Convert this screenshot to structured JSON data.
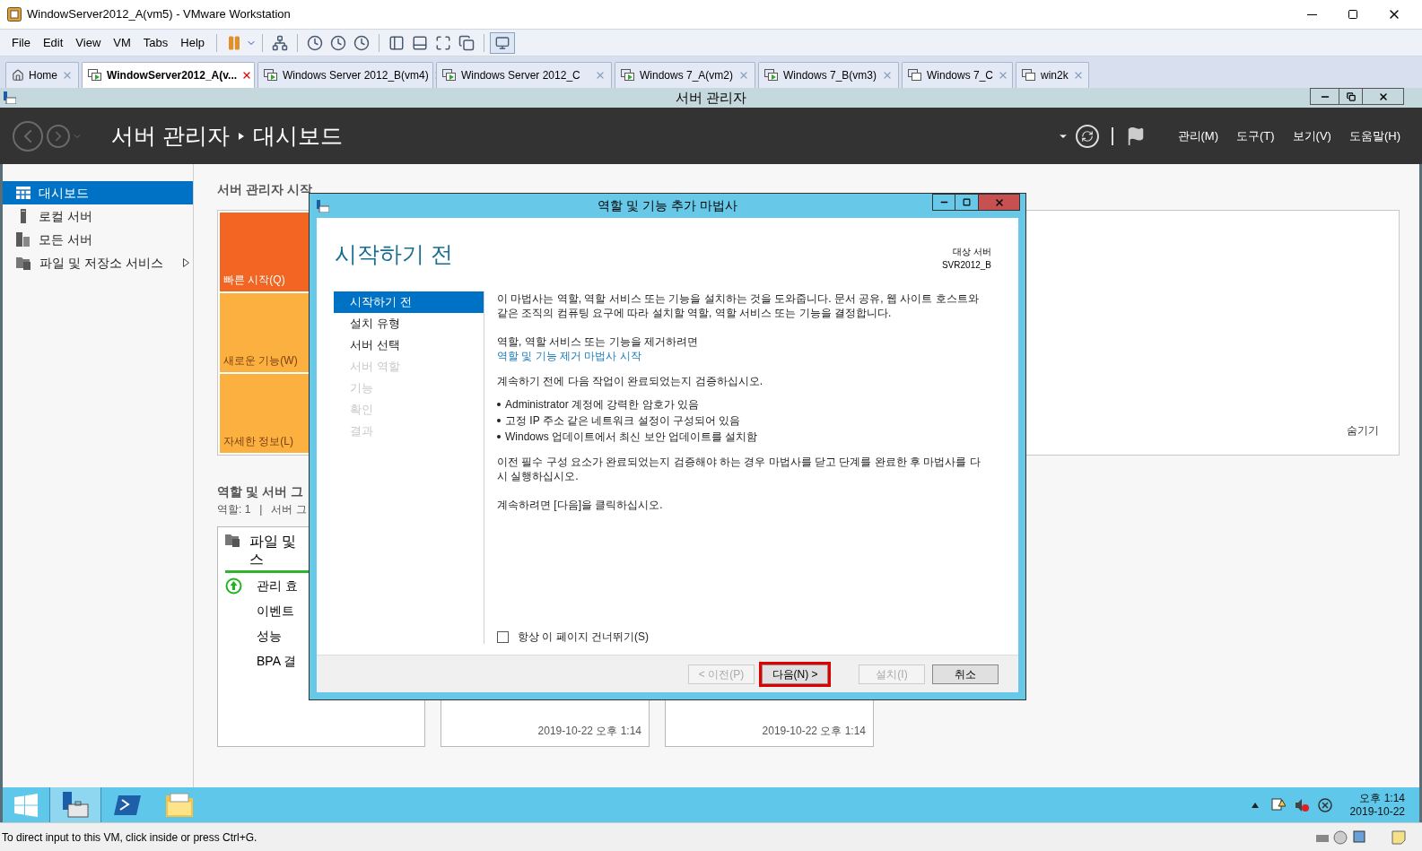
{
  "window": {
    "title": "WindowServer2012_A(vm5) - VMware Workstation"
  },
  "menu": [
    "File",
    "Edit",
    "View",
    "VM",
    "Tabs",
    "Help"
  ],
  "tabs": [
    {
      "label": "Home",
      "kind": "home",
      "selected": false
    },
    {
      "label": "WindowServer2012_A(v...",
      "kind": "vm",
      "selected": true,
      "running": true
    },
    {
      "label": "Windows Server 2012_B(vm4)",
      "kind": "vm",
      "selected": false,
      "running": true
    },
    {
      "label": "Windows Server 2012_C",
      "kind": "vm",
      "selected": false,
      "running": true
    },
    {
      "label": "Windows 7_A(vm2)",
      "kind": "vm",
      "selected": false,
      "running": true
    },
    {
      "label": "Windows 7_B(vm3)",
      "kind": "vm",
      "selected": false,
      "running": true
    },
    {
      "label": "Windows 7_C",
      "kind": "vm",
      "selected": false,
      "running": false
    },
    {
      "label": "win2k",
      "kind": "vm",
      "selected": false,
      "running": false
    }
  ],
  "guest": {
    "title": "서버 관리자",
    "breadcrumb": [
      "서버 관리자",
      "대시보드"
    ],
    "menu": [
      "관리(M)",
      "도구(T)",
      "보기(V)",
      "도움말(H)"
    ]
  },
  "sidebar": {
    "items": [
      {
        "label": "대시보드",
        "kind": "dashboard",
        "selected": true,
        "expandable": false
      },
      {
        "label": "로컬 서버",
        "kind": "local",
        "selected": false,
        "expandable": false
      },
      {
        "label": "모든 서버",
        "kind": "all",
        "selected": false,
        "expandable": false
      },
      {
        "label": "파일 및 저장소 서비스",
        "kind": "files",
        "selected": false,
        "expandable": true
      }
    ]
  },
  "dashboard": {
    "heading": "서버 관리자 시작",
    "tiles": [
      {
        "label": "빠른 시작(Q)",
        "color": "#f26522"
      },
      {
        "label": "새로운 기능(W)",
        "color": "#fbb040"
      },
      {
        "label": "자세한 정보(L)",
        "color": "#fbb040"
      }
    ],
    "hide": "숨기기",
    "roles_heading": "역할 및 서버 그",
    "roles_summary": "역할: 1   |   서버 그",
    "card": {
      "title": [
        "파일 및",
        "스"
      ],
      "rows": [
        {
          "label": "관리 효",
          "kind": "status"
        },
        {
          "label": "이벤트",
          "kind": "plain"
        },
        {
          "label": "성능",
          "kind": "plain"
        },
        {
          "label": "BPA 결",
          "kind": "plain"
        }
      ]
    },
    "timestamps": [
      "2019-10-22 오후 1:14",
      "2019-10-22 오후 1:14"
    ]
  },
  "wizard": {
    "title": "역할 및 기능 추가 마법사",
    "heading": "시작하기 전",
    "target_label": "대상 서버",
    "target": "SVR2012_B",
    "steps": [
      {
        "label": "시작하기 전",
        "selected": true,
        "disabled": false
      },
      {
        "label": "설치 유형",
        "selected": false,
        "disabled": false
      },
      {
        "label": "서버 선택",
        "selected": false,
        "disabled": false
      },
      {
        "label": "서버 역할",
        "selected": false,
        "disabled": true
      },
      {
        "label": "기능",
        "selected": false,
        "disabled": true
      },
      {
        "label": "확인",
        "selected": false,
        "disabled": true
      },
      {
        "label": "결과",
        "selected": false,
        "disabled": true
      }
    ],
    "content": [
      {
        "kind": "text",
        "text": "이 마법사는 역할, 역할 서비스 또는 기능을 설치하는 것을 도와줍니다. 문서 공유, 웹 사이트 호스트와 같은 조직의 컴퓨팅 요구에 따라 설치할 역할, 역할 서비스 또는 기능을 결정합니다."
      },
      {
        "kind": "text",
        "text": "역할, 역할 서비스 또는 기능을 제거하려면"
      },
      {
        "kind": "link",
        "text": "역할 및 기능 제거 마법사 시작"
      },
      {
        "kind": "text",
        "text": "계속하기 전에 다음 작업이 완료되었는지 검증하십시오."
      },
      {
        "kind": "bullet",
        "text": "Administrator 계정에 강력한 암호가 있음"
      },
      {
        "kind": "bullet",
        "text": "고정 IP 주소 같은 네트워크 설정이 구성되어 있음"
      },
      {
        "kind": "bullet",
        "text": "Windows 업데이트에서 최신 보안 업데이트를 설치함"
      },
      {
        "kind": "text",
        "text": "이전 필수 구성 요소가 완료되었는지 검증해야 하는 경우 마법사를 닫고 단계를 완료한 후 마법사를 다시 실행하십시오."
      },
      {
        "kind": "text",
        "text": "계속하려면 [다음]을 클릭하십시오."
      }
    ],
    "skip": {
      "label": "항상 이 페이지 건너뛰기(S)",
      "checked": false
    },
    "buttons": [
      {
        "label": "< 이전(P)",
        "disabled": true,
        "highlighted": false
      },
      {
        "label": "다음(N) >",
        "disabled": false,
        "highlighted": true
      },
      {
        "label": "설치(I)",
        "disabled": true,
        "highlighted": false
      },
      {
        "label": "취소",
        "disabled": false,
        "highlighted": false
      }
    ]
  },
  "taskbar": {
    "apps": [
      {
        "kind": "server-manager",
        "selected": true
      },
      {
        "kind": "powershell",
        "selected": false
      },
      {
        "kind": "explorer",
        "selected": false
      }
    ],
    "time": "오후 1:14",
    "date": "2019-10-22"
  },
  "status_bar": "To direct input to this VM, click inside or press Ctrl+G."
}
